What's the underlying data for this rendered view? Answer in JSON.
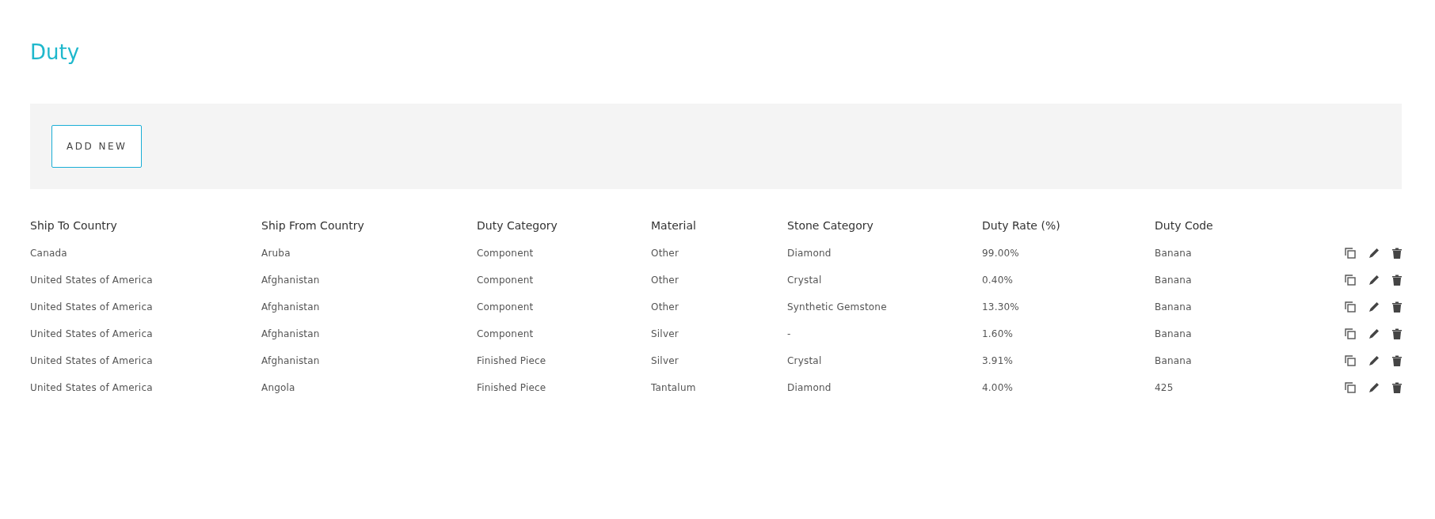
{
  "title": "Duty",
  "toolbar": {
    "add_button": "ADD NEW"
  },
  "table": {
    "columns": [
      "Ship To Country",
      "Ship From Country",
      "Duty Category",
      "Material",
      "Stone Category",
      "Duty Rate (%)",
      "Duty Code"
    ],
    "rows": [
      {
        "cells": [
          "Canada",
          "Aruba",
          "Component",
          "Other",
          "Diamond",
          "99.00%",
          "Banana"
        ]
      },
      {
        "cells": [
          "United States of America",
          "Afghanistan",
          "Component",
          "Other",
          "Crystal",
          "0.40%",
          "Banana"
        ]
      },
      {
        "cells": [
          "United States of America",
          "Afghanistan",
          "Component",
          "Other",
          "Synthetic Gemstone",
          "13.30%",
          "Banana"
        ]
      },
      {
        "cells": [
          "United States of America",
          "Afghanistan",
          "Component",
          "Silver",
          "-",
          "1.60%",
          "Banana"
        ]
      },
      {
        "cells": [
          "United States of America",
          "Afghanistan",
          "Finished Piece",
          "Silver",
          "Crystal",
          "3.91%",
          "Banana"
        ]
      },
      {
        "cells": [
          "United States of America",
          "Angola",
          "Finished Piece",
          "Tantalum",
          "Diamond",
          "4.00%",
          "425"
        ]
      }
    ]
  }
}
